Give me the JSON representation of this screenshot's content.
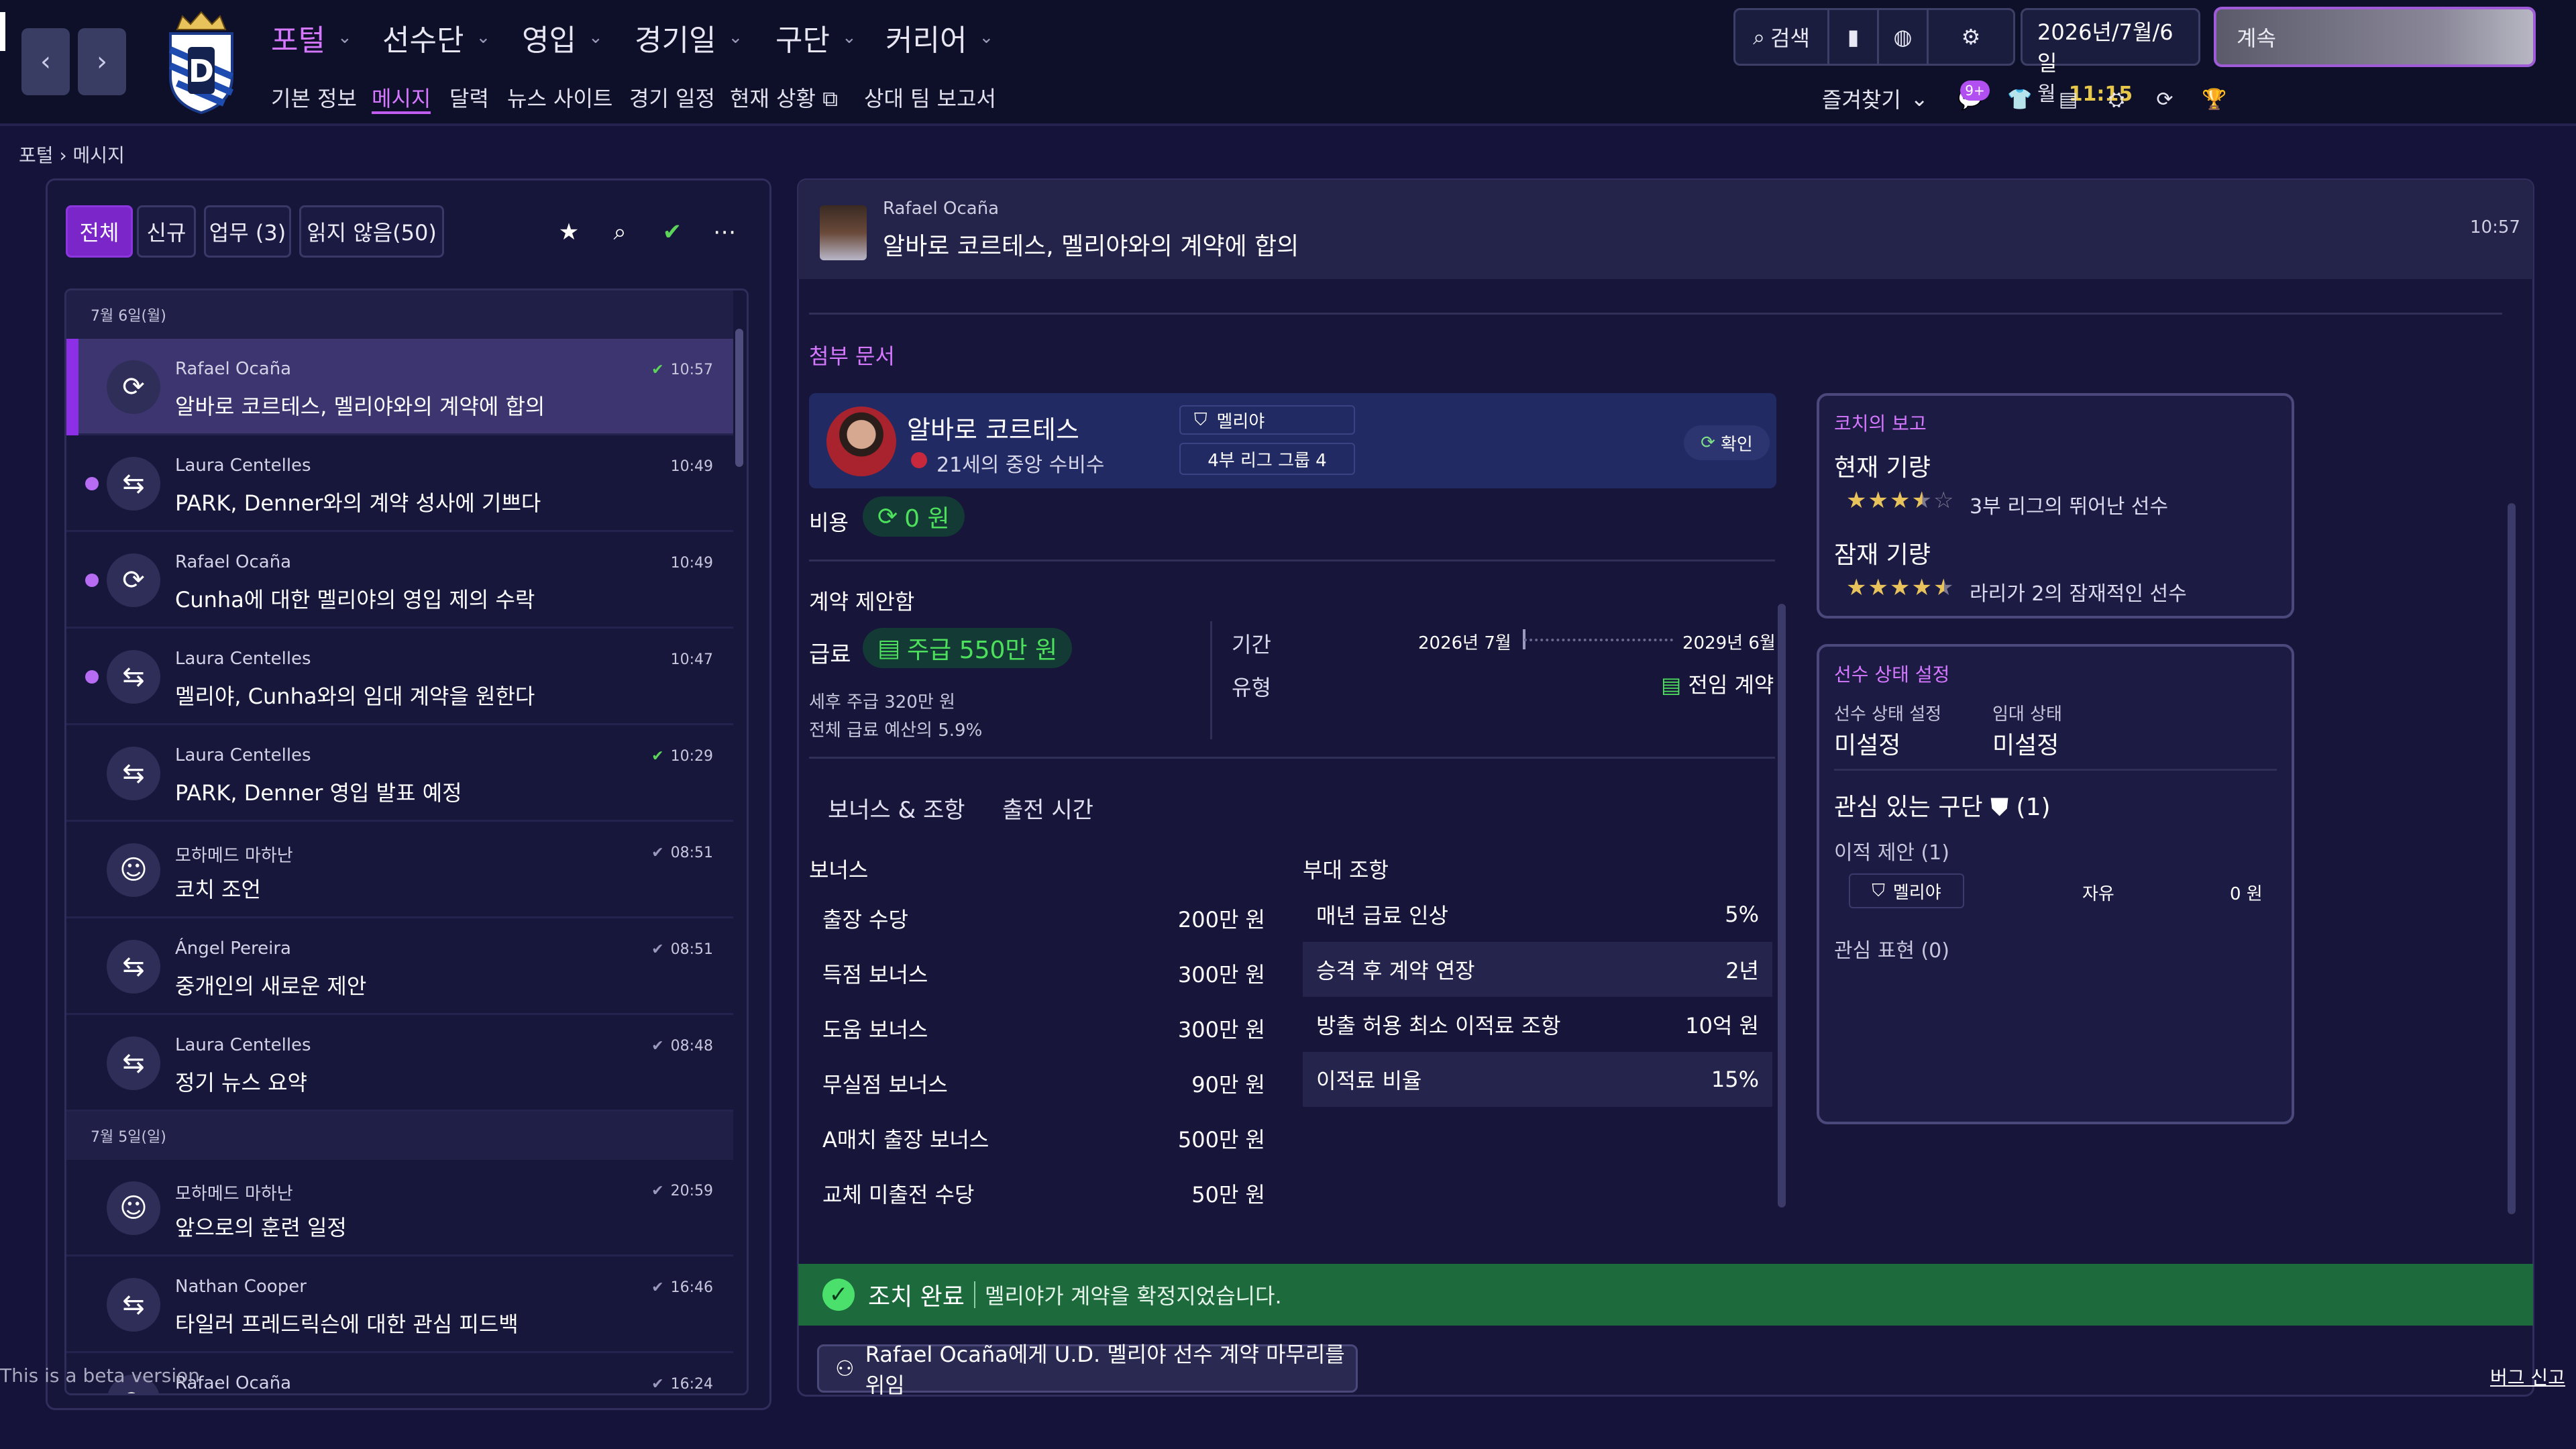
{
  "top_nav": {
    "main": [
      {
        "label": "포털",
        "active": true
      },
      {
        "label": "선수단",
        "active": false
      },
      {
        "label": "영입",
        "active": false
      },
      {
        "label": "경기일",
        "active": false
      },
      {
        "label": "구단",
        "active": false
      },
      {
        "label": "커리어",
        "active": false
      }
    ],
    "sub": [
      {
        "label": "기본 정보"
      },
      {
        "label": "메시지"
      },
      {
        "label": "달력"
      },
      {
        "label": "뉴스 사이트"
      },
      {
        "label": "경기 일정"
      },
      {
        "label": "현재 상황"
      },
      {
        "label": "상대 팀 보고서"
      }
    ],
    "search_label": "검색",
    "date_line1": "2026년/7월/6일",
    "date_weekday": "월",
    "time": "11:15",
    "continue_label": "계속",
    "favorites_label": "즐겨찾기",
    "notification_badge": "9+"
  },
  "breadcrumb": {
    "root": "포털",
    "current": "메시지"
  },
  "filters": [
    "전체",
    "신규",
    "업무 (3)",
    "읽지 않음(50)"
  ],
  "message_groups": [
    {
      "date": "7월 6일(월)",
      "messages": [
        {
          "sender": "Rafael Ocaña",
          "subject": "알바로 코르테스, 멜리야와의 계약에 합의",
          "time": "10:57",
          "icon": "refresh-icon",
          "unread": false,
          "selected": true,
          "check": "green"
        },
        {
          "sender": "Laura Centelles",
          "subject": "PARK, Denner와의 계약 성사에 기쁘다",
          "time": "10:49",
          "icon": "transfer-icon",
          "unread": true,
          "selected": false,
          "check": ""
        },
        {
          "sender": "Rafael Ocaña",
          "subject": "Cunha에 대한 멜리야의 영입 제의 수락",
          "time": "10:49",
          "icon": "refresh-icon",
          "unread": true,
          "selected": false,
          "check": ""
        },
        {
          "sender": "Laura Centelles",
          "subject": "멜리야, Cunha와의 임대 계약을 원한다",
          "time": "10:47",
          "icon": "transfer-icon",
          "unread": true,
          "selected": false,
          "check": ""
        },
        {
          "sender": "Laura Centelles",
          "subject": "PARK, Denner 영입 발표 예정",
          "time": "10:29",
          "icon": "transfer-icon",
          "unread": false,
          "selected": false,
          "check": "green"
        },
        {
          "sender": "모하메드 마하난",
          "subject": "코치 조언",
          "time": "08:51",
          "icon": "coach-group-icon",
          "unread": false,
          "selected": false,
          "check": "dim"
        },
        {
          "sender": "Ángel Pereira",
          "subject": "중개인의 새로운 제안",
          "time": "08:51",
          "icon": "transfer-icon",
          "unread": false,
          "selected": false,
          "check": "dim"
        },
        {
          "sender": "Laura Centelles",
          "subject": "정기 뉴스 요약",
          "time": "08:48",
          "icon": "transfer-icon",
          "unread": false,
          "selected": false,
          "check": "dim"
        }
      ]
    },
    {
      "date": "7월 5일(일)",
      "messages": [
        {
          "sender": "모하메드 마하난",
          "subject": "앞으로의 훈련 일정",
          "time": "20:59",
          "icon": "coach-group-icon",
          "unread": false,
          "selected": false,
          "check": "dim"
        },
        {
          "sender": "Nathan Cooper",
          "subject": "타일러 프레드릭슨에 대한 관심 피드백",
          "time": "16:46",
          "icon": "transfer-icon",
          "unread": false,
          "selected": false,
          "check": "dim"
        },
        {
          "sender": "Rafael Ocaña",
          "subject": "",
          "time": "16:24",
          "icon": "refresh-icon",
          "unread": false,
          "selected": false,
          "check": "dim"
        }
      ]
    }
  ],
  "message": {
    "sender": "Rafael Ocaña",
    "subject": "알바로 코르테스, 멜리야와의 계약에 합의",
    "time": "10:57",
    "attachment_header": "첨부 문서",
    "player": {
      "name": "알바로 코르테스",
      "description": "21세의 중앙 수비수",
      "club": "멜리야",
      "league": "4부 리그 그룹 4",
      "confirm_label": "확인"
    },
    "fee_label": "비용",
    "fee_value": "0 원",
    "contract_header": "계약 제안함",
    "wage_label": "급료",
    "wage_value": "주급 550만 원",
    "wage_after_tax": "세후 주급 320만 원",
    "wage_budget_share": "전체 급료 예산의 5.9%",
    "term_label": "기간",
    "term_start": "2026년 7월",
    "term_end": "2029년 6월",
    "type_label": "유형",
    "type_value": "전임 계약",
    "tabs": [
      "보너스 & 조항",
      "출전 시간"
    ],
    "bonus_header": "보너스",
    "bonuses": [
      {
        "name": "출장 수당",
        "value": "200만 원"
      },
      {
        "name": "득점 보너스",
        "value": "300만 원"
      },
      {
        "name": "도움 보너스",
        "value": "300만 원"
      },
      {
        "name": "무실점 보너스",
        "value": "90만 원"
      },
      {
        "name": "A매치 출장 보너스",
        "value": "500만 원"
      },
      {
        "name": "교체 미출전 수당",
        "value": "50만 원"
      }
    ],
    "clause_header": "부대 조항",
    "clauses": [
      {
        "name": "매년 급료 인상",
        "value": "5%"
      },
      {
        "name": "승격 후 계약 연장",
        "value": "2년"
      },
      {
        "name": "방출 허용 최소 이적료 조항",
        "value": "10억 원"
      },
      {
        "name": "이적료 비율",
        "value": "15%"
      }
    ]
  },
  "coach_report": {
    "title": "코치의 보고",
    "current_label": "현재 기량",
    "current_stars": 3.5,
    "current_desc": "3부 리그의 뛰어난 선수",
    "potential_label": "잠재 기량",
    "potential_stars": 4.5,
    "potential_desc": "라리가 2의 잠재적인 선수"
  },
  "player_status": {
    "title": "선수 상태 설정",
    "status_label": "선수 상태 설정",
    "status_value": "미설정",
    "loan_label": "임대 상태",
    "loan_value": "미설정",
    "interested_clubs": "관심 있는 구단",
    "interested_count": "(1)",
    "transfer_offers": "이적 제안 (1)",
    "offer_club": "멜리야",
    "offer_type": "자유",
    "offer_fee": "0 원",
    "interest_shown": "관심 표현 (0)"
  },
  "completion": {
    "label": "조치 완료",
    "text": "멜리야가 계약을 확정지었습니다."
  },
  "action_button": "Rafael Ocaña에게 U.D. 멜리야 선수 계약 마무리를 위임",
  "beta_notice": "This is a beta version",
  "bug_report": "버그 신고",
  "colors": {
    "accent": "#d678ff",
    "active_tab": "#7a26c8",
    "success": "#1d6a3c",
    "money": "#4de05c",
    "star": "#e8c25a"
  }
}
